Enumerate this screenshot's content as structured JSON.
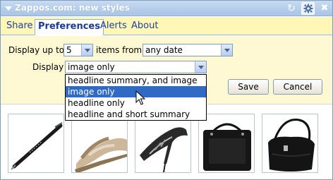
{
  "window": {
    "title": "Zappos.com: new styles"
  },
  "icons": {
    "title_arrow": "chevron-down-icon",
    "refresh": "refresh-icon",
    "settings": "gear-icon",
    "close": "close-icon",
    "cursor": "mouse-pointer-icon"
  },
  "tabs": [
    {
      "label": "Share"
    },
    {
      "label": "Preferences"
    },
    {
      "label": "Alerts"
    },
    {
      "label": "About"
    }
  ],
  "prefs": {
    "display_up_to_label": "Display up to",
    "count_value": "5",
    "items_from_label": "items from",
    "date_value": "any date",
    "display_label": "Display",
    "display_value": "image only",
    "display_options": [
      "headline summary, and image",
      "image only",
      "headline only",
      "headline and short summary"
    ],
    "selected_option_index": 1,
    "save_label": "Save",
    "cancel_label": "Cancel"
  },
  "products": [
    {
      "name": "pen-image"
    },
    {
      "name": "sandal-image"
    },
    {
      "name": "high-heel-image"
    },
    {
      "name": "black-tote-image"
    },
    {
      "name": "black-handbag-image"
    }
  ],
  "colors": {
    "titlebar": "#b5cdea",
    "tab_link": "#1f3f9f",
    "prefs_bg": "#fef9d2",
    "selected_option": "#316ac5"
  }
}
